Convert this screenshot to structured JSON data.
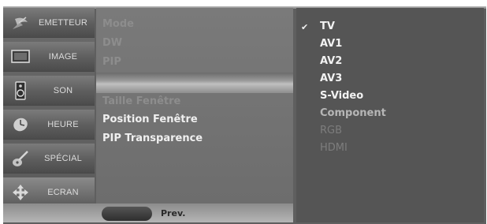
{
  "sidebar": {
    "items": [
      {
        "label": "EMETTEUR",
        "icon": "satellite-dish-icon"
      },
      {
        "label": "IMAGE",
        "icon": "monitor-icon"
      },
      {
        "label": "SON",
        "icon": "speaker-icon"
      },
      {
        "label": "HEURE",
        "icon": "clock-icon"
      },
      {
        "label": "SPÉCIAL",
        "icon": "guitar-icon"
      },
      {
        "label": "ECRAN",
        "icon": "move-arrows-icon"
      }
    ],
    "active": "ECRAN"
  },
  "submenu": {
    "items": [
      {
        "label": "Mode",
        "state": "dim"
      },
      {
        "label": "DW",
        "state": "dim"
      },
      {
        "label": "PIP",
        "state": "dim"
      },
      {
        "label": "",
        "state": "selected"
      },
      {
        "label": "Taille Fenêtre",
        "state": "dim"
      },
      {
        "label": "Position Fenêtre",
        "state": "on"
      },
      {
        "label": "PIP Transparence",
        "state": "on"
      }
    ]
  },
  "bottom": {
    "prev_label": "Prev."
  },
  "options": {
    "items": [
      {
        "label": "TV",
        "state": "checked"
      },
      {
        "label": "AV1",
        "state": "on"
      },
      {
        "label": "AV2",
        "state": "on"
      },
      {
        "label": "AV3",
        "state": "on"
      },
      {
        "label": "S-Video",
        "state": "on"
      },
      {
        "label": "Component",
        "state": "dim"
      },
      {
        "label": "RGB",
        "state": "off"
      },
      {
        "label": "HDMI",
        "state": "off"
      }
    ],
    "check_glyph": "✔"
  }
}
